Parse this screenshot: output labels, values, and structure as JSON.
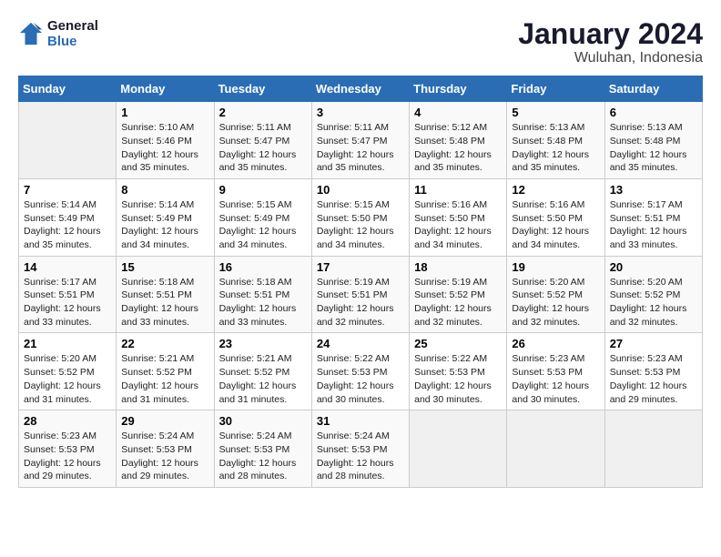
{
  "logo": {
    "line1": "General",
    "line2": "Blue"
  },
  "title": "January 2024",
  "subtitle": "Wuluhan, Indonesia",
  "days_of_week": [
    "Sunday",
    "Monday",
    "Tuesday",
    "Wednesday",
    "Thursday",
    "Friday",
    "Saturday"
  ],
  "weeks": [
    [
      {
        "day": "",
        "sunrise": "",
        "sunset": "",
        "daylight": ""
      },
      {
        "day": "1",
        "sunrise": "Sunrise: 5:10 AM",
        "sunset": "Sunset: 5:46 PM",
        "daylight": "Daylight: 12 hours and 35 minutes."
      },
      {
        "day": "2",
        "sunrise": "Sunrise: 5:11 AM",
        "sunset": "Sunset: 5:47 PM",
        "daylight": "Daylight: 12 hours and 35 minutes."
      },
      {
        "day": "3",
        "sunrise": "Sunrise: 5:11 AM",
        "sunset": "Sunset: 5:47 PM",
        "daylight": "Daylight: 12 hours and 35 minutes."
      },
      {
        "day": "4",
        "sunrise": "Sunrise: 5:12 AM",
        "sunset": "Sunset: 5:48 PM",
        "daylight": "Daylight: 12 hours and 35 minutes."
      },
      {
        "day": "5",
        "sunrise": "Sunrise: 5:13 AM",
        "sunset": "Sunset: 5:48 PM",
        "daylight": "Daylight: 12 hours and 35 minutes."
      },
      {
        "day": "6",
        "sunrise": "Sunrise: 5:13 AM",
        "sunset": "Sunset: 5:48 PM",
        "daylight": "Daylight: 12 hours and 35 minutes."
      }
    ],
    [
      {
        "day": "7",
        "sunrise": "Sunrise: 5:14 AM",
        "sunset": "Sunset: 5:49 PM",
        "daylight": "Daylight: 12 hours and 35 minutes."
      },
      {
        "day": "8",
        "sunrise": "Sunrise: 5:14 AM",
        "sunset": "Sunset: 5:49 PM",
        "daylight": "Daylight: 12 hours and 34 minutes."
      },
      {
        "day": "9",
        "sunrise": "Sunrise: 5:15 AM",
        "sunset": "Sunset: 5:49 PM",
        "daylight": "Daylight: 12 hours and 34 minutes."
      },
      {
        "day": "10",
        "sunrise": "Sunrise: 5:15 AM",
        "sunset": "Sunset: 5:50 PM",
        "daylight": "Daylight: 12 hours and 34 minutes."
      },
      {
        "day": "11",
        "sunrise": "Sunrise: 5:16 AM",
        "sunset": "Sunset: 5:50 PM",
        "daylight": "Daylight: 12 hours and 34 minutes."
      },
      {
        "day": "12",
        "sunrise": "Sunrise: 5:16 AM",
        "sunset": "Sunset: 5:50 PM",
        "daylight": "Daylight: 12 hours and 34 minutes."
      },
      {
        "day": "13",
        "sunrise": "Sunrise: 5:17 AM",
        "sunset": "Sunset: 5:51 PM",
        "daylight": "Daylight: 12 hours and 33 minutes."
      }
    ],
    [
      {
        "day": "14",
        "sunrise": "Sunrise: 5:17 AM",
        "sunset": "Sunset: 5:51 PM",
        "daylight": "Daylight: 12 hours and 33 minutes."
      },
      {
        "day": "15",
        "sunrise": "Sunrise: 5:18 AM",
        "sunset": "Sunset: 5:51 PM",
        "daylight": "Daylight: 12 hours and 33 minutes."
      },
      {
        "day": "16",
        "sunrise": "Sunrise: 5:18 AM",
        "sunset": "Sunset: 5:51 PM",
        "daylight": "Daylight: 12 hours and 33 minutes."
      },
      {
        "day": "17",
        "sunrise": "Sunrise: 5:19 AM",
        "sunset": "Sunset: 5:51 PM",
        "daylight": "Daylight: 12 hours and 32 minutes."
      },
      {
        "day": "18",
        "sunrise": "Sunrise: 5:19 AM",
        "sunset": "Sunset: 5:52 PM",
        "daylight": "Daylight: 12 hours and 32 minutes."
      },
      {
        "day": "19",
        "sunrise": "Sunrise: 5:20 AM",
        "sunset": "Sunset: 5:52 PM",
        "daylight": "Daylight: 12 hours and 32 minutes."
      },
      {
        "day": "20",
        "sunrise": "Sunrise: 5:20 AM",
        "sunset": "Sunset: 5:52 PM",
        "daylight": "Daylight: 12 hours and 32 minutes."
      }
    ],
    [
      {
        "day": "21",
        "sunrise": "Sunrise: 5:20 AM",
        "sunset": "Sunset: 5:52 PM",
        "daylight": "Daylight: 12 hours and 31 minutes."
      },
      {
        "day": "22",
        "sunrise": "Sunrise: 5:21 AM",
        "sunset": "Sunset: 5:52 PM",
        "daylight": "Daylight: 12 hours and 31 minutes."
      },
      {
        "day": "23",
        "sunrise": "Sunrise: 5:21 AM",
        "sunset": "Sunset: 5:52 PM",
        "daylight": "Daylight: 12 hours and 31 minutes."
      },
      {
        "day": "24",
        "sunrise": "Sunrise: 5:22 AM",
        "sunset": "Sunset: 5:53 PM",
        "daylight": "Daylight: 12 hours and 30 minutes."
      },
      {
        "day": "25",
        "sunrise": "Sunrise: 5:22 AM",
        "sunset": "Sunset: 5:53 PM",
        "daylight": "Daylight: 12 hours and 30 minutes."
      },
      {
        "day": "26",
        "sunrise": "Sunrise: 5:23 AM",
        "sunset": "Sunset: 5:53 PM",
        "daylight": "Daylight: 12 hours and 30 minutes."
      },
      {
        "day": "27",
        "sunrise": "Sunrise: 5:23 AM",
        "sunset": "Sunset: 5:53 PM",
        "daylight": "Daylight: 12 hours and 29 minutes."
      }
    ],
    [
      {
        "day": "28",
        "sunrise": "Sunrise: 5:23 AM",
        "sunset": "Sunset: 5:53 PM",
        "daylight": "Daylight: 12 hours and 29 minutes."
      },
      {
        "day": "29",
        "sunrise": "Sunrise: 5:24 AM",
        "sunset": "Sunset: 5:53 PM",
        "daylight": "Daylight: 12 hours and 29 minutes."
      },
      {
        "day": "30",
        "sunrise": "Sunrise: 5:24 AM",
        "sunset": "Sunset: 5:53 PM",
        "daylight": "Daylight: 12 hours and 28 minutes."
      },
      {
        "day": "31",
        "sunrise": "Sunrise: 5:24 AM",
        "sunset": "Sunset: 5:53 PM",
        "daylight": "Daylight: 12 hours and 28 minutes."
      },
      {
        "day": "",
        "sunrise": "",
        "sunset": "",
        "daylight": ""
      },
      {
        "day": "",
        "sunrise": "",
        "sunset": "",
        "daylight": ""
      },
      {
        "day": "",
        "sunrise": "",
        "sunset": "",
        "daylight": ""
      }
    ]
  ]
}
